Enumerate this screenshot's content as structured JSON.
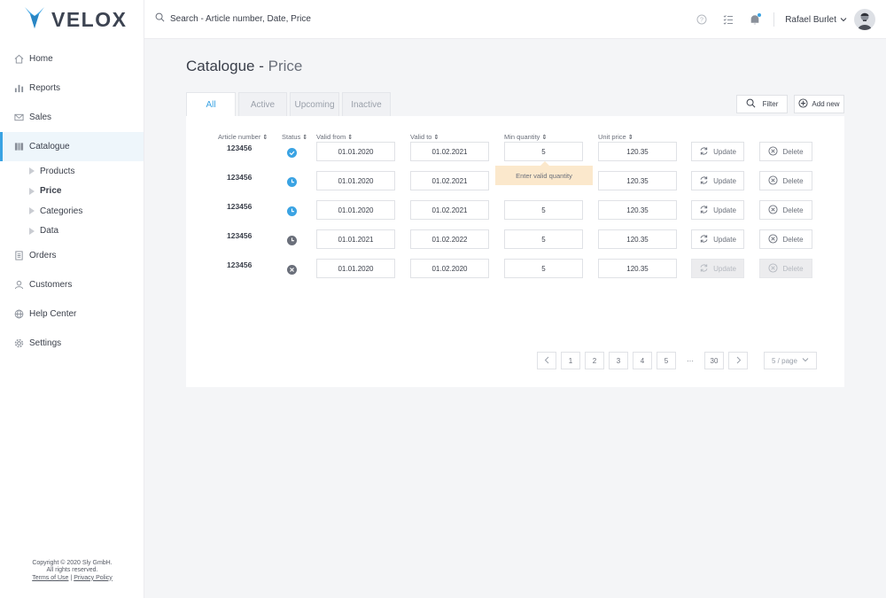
{
  "brand": {
    "name": "VELOX",
    "accent": "#3aa3e3"
  },
  "search": {
    "placeholder": "Search - Article number, Date, Price"
  },
  "user": {
    "name": "Rafael Burlet"
  },
  "nav": {
    "home": "Home",
    "reports": "Reports",
    "sales": "Sales",
    "catalogue": "Catalogue",
    "sub": [
      "Products",
      "Price",
      "Categories",
      "Data"
    ],
    "orders": "Orders",
    "customers": "Customers",
    "help": "Help Center",
    "settings": "Settings"
  },
  "footer": {
    "copyright": "Copyright © 2020 Sly GmbH.",
    "rights": "All rights reserved.",
    "terms": "Terms of Use",
    "sep": "|",
    "privacy": "Privacy Policy"
  },
  "page": {
    "title_main": "Catalogue",
    "title_sep": " - ",
    "title_sub": "Price"
  },
  "tabs": [
    "All",
    "Active",
    "Upcoming",
    "Inactive"
  ],
  "toolbar": {
    "filter": "Filter",
    "add": "Add new"
  },
  "columns": {
    "article": "Article number",
    "status": "Status",
    "valid_from": "Valid from",
    "valid_to": "Valid to",
    "min_qty": "Min quantity",
    "unit_price": "Unit price",
    "sort_glyph": "⇕"
  },
  "rows": [
    {
      "article": "123456",
      "status": "active",
      "valid_from": "01.01.2020",
      "valid_to": "01.02.2021",
      "min_qty": "5",
      "unit_price": "120.35"
    },
    {
      "article": "123456",
      "status": "upcoming",
      "valid_from": "01.01.2020",
      "valid_to": "01.02.2021",
      "min_qty": "",
      "unit_price": "120.35"
    },
    {
      "article": "123456",
      "status": "upcoming",
      "valid_from": "01.01.2020",
      "valid_to": "01.02.2021",
      "min_qty": "5",
      "unit_price": "120.35"
    },
    {
      "article": "123456",
      "status": "scheduled",
      "valid_from": "01.01.2021",
      "valid_to": "01.02.2022",
      "min_qty": "5",
      "unit_price": "120.35"
    },
    {
      "article": "123456",
      "status": "inactive",
      "valid_from": "01.01.2020",
      "valid_to": "01.02.2020",
      "min_qty": "5",
      "unit_price": "120.35"
    }
  ],
  "actions": {
    "update": "Update",
    "delete": "Delete"
  },
  "tooltip": {
    "text": "Enter valid quantity"
  },
  "pagination": {
    "pages": [
      "1",
      "2",
      "3",
      "4",
      "5"
    ],
    "dots": "···",
    "last": "30",
    "page_size": "5 / page"
  },
  "colors": {
    "active": "#3aa3e3",
    "inactive": "#6a6f7a",
    "tooltip": "#fbe8cc"
  }
}
